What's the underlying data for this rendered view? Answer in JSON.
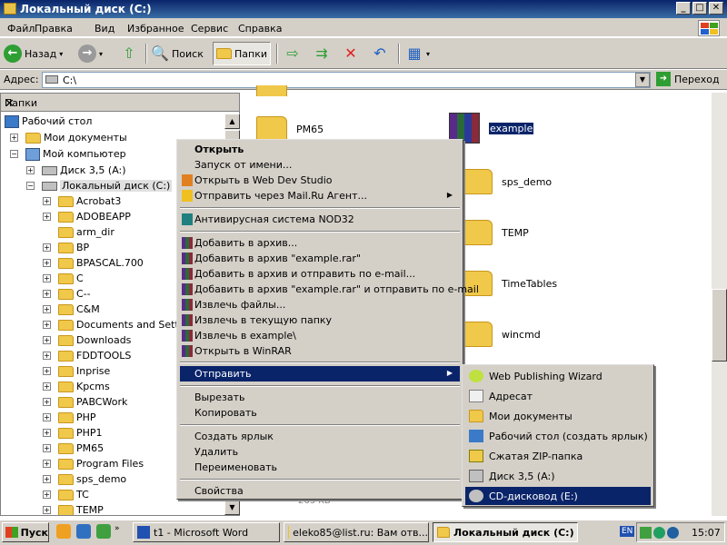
{
  "window": {
    "title": "Локальный диск (C:)"
  },
  "menu": [
    "Файл",
    "Правка",
    "Вид",
    "Избранное",
    "Сервис",
    "Справка"
  ],
  "toolbar": {
    "back": "Назад",
    "search": "Поиск",
    "folders": "Папки"
  },
  "address": {
    "label": "Адрес:",
    "value": "C:\\",
    "go": "Переход"
  },
  "folder_pane": {
    "title": "Папки",
    "close": "✕"
  },
  "tree": {
    "desktop": "Рабочий стол",
    "mydocs": "Мои документы",
    "mycomp": "Мой компьютер",
    "floppy": "Диск 3,5 (A:)",
    "cdrive": "Локальный диск (C:)",
    "folders": [
      "Acrobat3",
      "ADOBEAPP",
      "arm_dir",
      "BP",
      "BPASCAL.700",
      "C",
      "C--",
      "C&M",
      "Documents and Settings",
      "Downloads",
      "FDDTOOLS",
      "Inprise",
      "Kpcms",
      "PABCWork",
      "PHP",
      "PHP1",
      "PM65",
      "Program Files",
      "sps_demo",
      "TC",
      "TEMP"
    ]
  },
  "contents": {
    "left": [
      "PM65"
    ],
    "right": [
      "example",
      "sps_demo",
      "TEMP",
      "TimeTables",
      "wincmd"
    ],
    "partial": "263 KB"
  },
  "context_menu": {
    "open": "Открыть",
    "run_as": "Запуск от имени...",
    "open_webdev": "Открыть в Web Dev Studio",
    "send_mailru": "Отправить через Mail.Ru Агент...",
    "nod32": "Антивирусная система NOD32",
    "add_archive": "Добавить в архив...",
    "add_example": "Добавить в архив \"example.rar\"",
    "add_email": "Добавить в архив и отправить по e-mail...",
    "add_example_email": "Добавить в архив \"example.rar\" и отправить по e-mail",
    "extract": "Извлечь файлы...",
    "extract_here": "Извлечь в текущую папку",
    "extract_to": "Извлечь в example\\",
    "open_winrar": "Открыть в WinRAR",
    "send_to": "Отправить",
    "cut": "Вырезать",
    "copy": "Копировать",
    "shortcut": "Создать ярлык",
    "delete": "Удалить",
    "rename": "Переименовать",
    "properties": "Свойства"
  },
  "send_to_menu": [
    "Web Publishing Wizard",
    "Адресат",
    "Мои документы",
    "Рабочий стол (создать ярлык)",
    "Сжатая ZIP-папка",
    "Диск 3,5 (A:)",
    "CD-дисковод (E:)"
  ],
  "taskbar": {
    "start": "Пуск",
    "tasks": [
      "t1 - Microsoft Word",
      "eleko85@list.ru: Вам отв...",
      "Локальный диск (C:)"
    ],
    "lang": "EN",
    "clock": "15:07"
  }
}
